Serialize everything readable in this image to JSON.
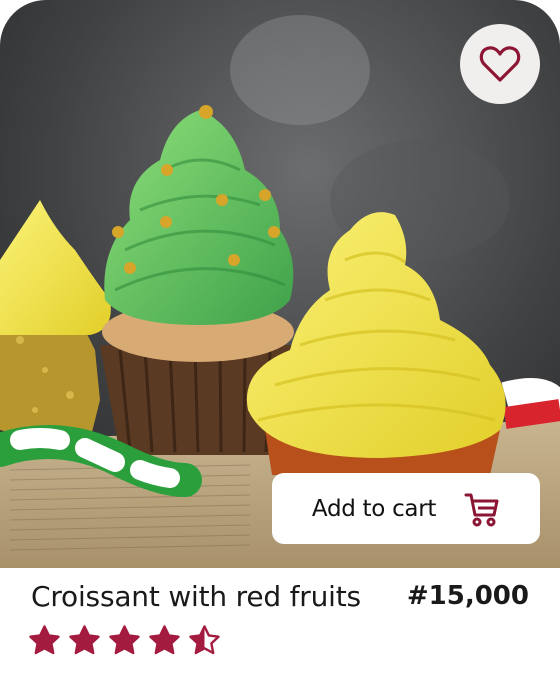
{
  "product": {
    "name": "Croissant with red fruits",
    "price": "#15,000",
    "rating": 4.5,
    "rating_max": 5
  },
  "actions": {
    "add_to_cart_label": "Add to cart"
  },
  "icons": {
    "favorite": "heart-outline-icon",
    "cart": "shopping-cart-icon",
    "star": "star-icon"
  },
  "colors": {
    "accent": "#8c1534",
    "star": "#a31b3f",
    "text": "#1a1a1a"
  }
}
